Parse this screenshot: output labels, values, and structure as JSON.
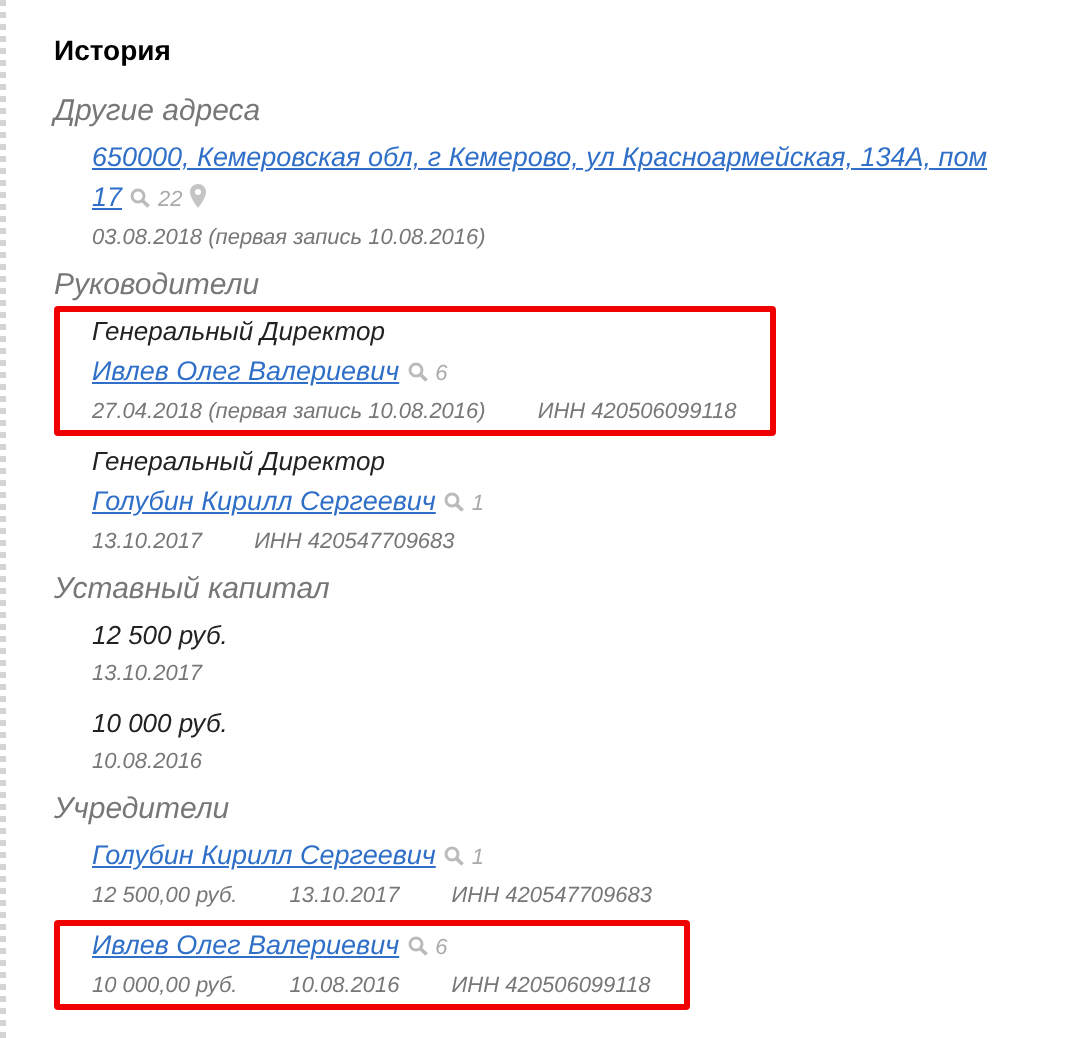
{
  "title": "История",
  "sections": [
    {
      "title": "Другие адреса",
      "entries": [
        {
          "kind": "address",
          "highlighted": false,
          "link_lines": [
            "650000, Кемеровская обл, г Кемерово, ул Красноармейская, 134А, пом",
            "17"
          ],
          "count": "22",
          "meta": [
            "03.08.2018 (первая запись 10.08.2016)"
          ]
        }
      ]
    },
    {
      "title": "Руководители",
      "entries": [
        {
          "kind": "person",
          "highlighted": true,
          "role": "Генеральный Директор",
          "link": "Ивлев Олег Валериевич",
          "count": "6",
          "meta": [
            "27.04.2018 (первая запись 10.08.2016)",
            "ИНН 420506099118"
          ]
        },
        {
          "kind": "person",
          "highlighted": false,
          "role": "Генеральный Директор",
          "link": "Голубин Кирилл Сергеевич",
          "count": "1",
          "meta": [
            "13.10.2017",
            "ИНН 420547709683"
          ]
        }
      ]
    },
    {
      "title": "Уставный капитал",
      "entries": [
        {
          "kind": "amount",
          "highlighted": false,
          "value": "12 500 руб.",
          "meta": [
            "13.10.2017"
          ]
        },
        {
          "kind": "amount",
          "highlighted": false,
          "value": "10 000 руб.",
          "meta": [
            "10.08.2016"
          ]
        }
      ]
    },
    {
      "title": "Учредители",
      "entries": [
        {
          "kind": "person",
          "highlighted": false,
          "link": "Голубин Кирилл Сергеевич",
          "count": "1",
          "meta": [
            "12 500,00 руб.",
            "13.10.2017",
            "ИНН 420547709683"
          ]
        },
        {
          "kind": "person",
          "highlighted": true,
          "link": "Ивлев Олег Валериевич",
          "count": "6",
          "meta": [
            "10 000,00 руб.",
            "10.08.2016",
            "ИНН 420506099118"
          ]
        }
      ]
    }
  ]
}
